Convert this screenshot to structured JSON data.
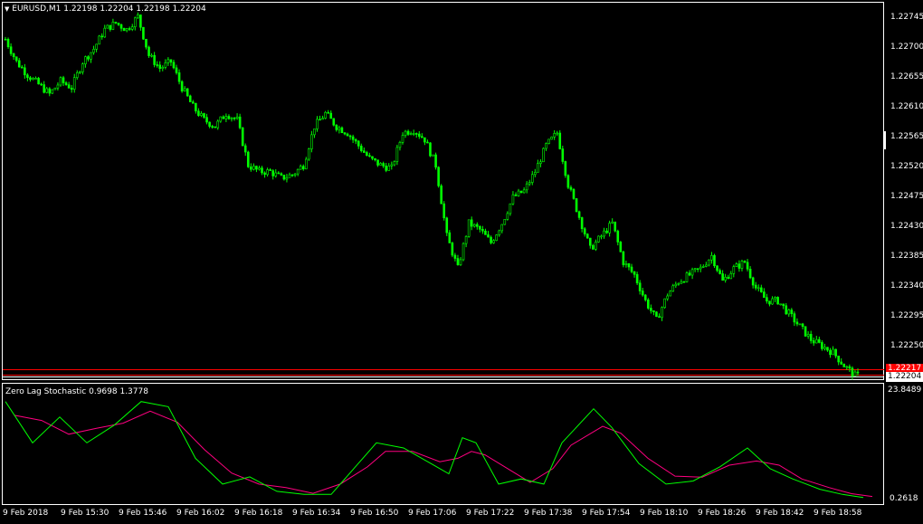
{
  "header": {
    "symbol_line": "EURUSD,M1  1.22198 1.22204 1.22198 1.22204",
    "arrow": "▼"
  },
  "price_axis": {
    "ticks": [
      "1.22745",
      "1.22700",
      "1.22655",
      "1.22610",
      "1.22565",
      "1.22520",
      "1.22475",
      "1.22430",
      "1.22385",
      "1.22340",
      "1.22295",
      "1.22250"
    ],
    "current_price_label": "1.22204",
    "red_line_label": "1.22217",
    "red_color": "#ff0000"
  },
  "indicator": {
    "title": "Zero Lag Stochastic 0.9698 1.3778",
    "top_value": "23.8489",
    "bottom_value": "0.2618",
    "main_color": "#00ff00",
    "signal_color": "#ff0080"
  },
  "time_axis": {
    "labels": [
      "9 Feb 2018",
      "9 Feb 15:30",
      "9 Feb 15:46",
      "9 Feb 16:02",
      "9 Feb 16:18",
      "9 Feb 16:34",
      "9 Feb 16:50",
      "9 Feb 17:06",
      "9 Feb 17:22",
      "9 Feb 17:38",
      "9 Feb 17:54",
      "9 Feb 18:10",
      "9 Feb 18:26",
      "9 Feb 18:42",
      "9 Feb 18:58"
    ]
  },
  "colors": {
    "background": "#000000",
    "candle": "#00ff00",
    "frame": "#ffffff"
  },
  "chart_data": {
    "type": "candlestick",
    "symbol": "EURUSD",
    "timeframe": "M1",
    "ylim": [
      1.222,
      1.2278
    ],
    "close_path": [
      [
        0,
        1.22725
      ],
      [
        4,
        1.2269
      ],
      [
        8,
        1.2267
      ],
      [
        12,
        1.22655
      ],
      [
        16,
        1.2264
      ],
      [
        20,
        1.2266
      ],
      [
        24,
        1.2265
      ],
      [
        28,
        1.2269
      ],
      [
        32,
        1.2271
      ],
      [
        36,
        1.2274
      ],
      [
        40,
        1.2275
      ],
      [
        44,
        1.2274
      ],
      [
        48,
        1.2276
      ],
      [
        52,
        1.227
      ],
      [
        56,
        1.2268
      ],
      [
        60,
        1.2269
      ],
      [
        64,
        1.2265
      ],
      [
        68,
        1.2262
      ],
      [
        72,
        1.226
      ],
      [
        76,
        1.2259
      ],
      [
        80,
        1.2261
      ],
      [
        84,
        1.226
      ],
      [
        88,
        1.2253
      ],
      [
        92,
        1.2252
      ],
      [
        96,
        1.2252
      ],
      [
        100,
        1.2251
      ],
      [
        104,
        1.22515
      ],
      [
        108,
        1.2253
      ],
      [
        112,
        1.2259
      ],
      [
        116,
        1.2261
      ],
      [
        120,
        1.2259
      ],
      [
        124,
        1.2258
      ],
      [
        128,
        1.2256
      ],
      [
        132,
        1.2254
      ],
      [
        136,
        1.2253
      ],
      [
        140,
        1.22525
      ],
      [
        144,
        1.2258
      ],
      [
        148,
        1.22585
      ],
      [
        152,
        1.2257
      ],
      [
        156,
        1.2253
      ],
      [
        160,
        1.2242
      ],
      [
        164,
        1.2237
      ],
      [
        168,
        1.2244
      ],
      [
        172,
        1.2243
      ],
      [
        176,
        1.2241
      ],
      [
        180,
        1.2244
      ],
      [
        184,
        1.2248
      ],
      [
        188,
        1.2249
      ],
      [
        192,
        1.2252
      ],
      [
        196,
        1.2256
      ],
      [
        200,
        1.2258
      ],
      [
        204,
        1.225
      ],
      [
        208,
        1.2245
      ],
      [
        212,
        1.224
      ],
      [
        216,
        1.2242
      ],
      [
        220,
        1.2244
      ],
      [
        224,
        1.2238
      ],
      [
        228,
        1.2236
      ],
      [
        232,
        1.2232
      ],
      [
        236,
        1.2229
      ],
      [
        240,
        1.2233
      ],
      [
        244,
        1.2235
      ],
      [
        248,
        1.2236
      ],
      [
        252,
        1.2237
      ],
      [
        256,
        1.2239
      ],
      [
        260,
        1.2235
      ],
      [
        264,
        1.2237
      ],
      [
        268,
        1.2238
      ],
      [
        272,
        1.2234
      ],
      [
        276,
        1.2232
      ],
      [
        280,
        1.2232
      ],
      [
        284,
        1.223
      ],
      [
        288,
        1.2228
      ],
      [
        292,
        1.2226
      ],
      [
        296,
        1.2225
      ],
      [
        300,
        1.2224
      ],
      [
        304,
        1.2222
      ],
      [
        308,
        1.22204
      ]
    ],
    "last": {
      "open": 1.22198,
      "high": 1.22204,
      "low": 1.22198,
      "close": 1.22204
    },
    "indicator": {
      "name": "Zero Lag Stochastic",
      "values": [
        0.9698,
        1.3778
      ],
      "range": [
        0.2618,
        23.8489
      ]
    }
  }
}
